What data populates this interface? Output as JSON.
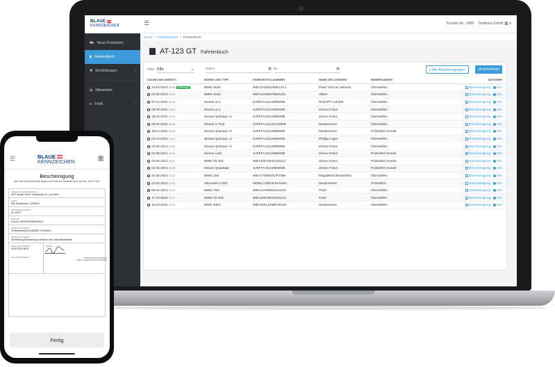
{
  "laptop": {
    "brand": {
      "top": "BLAUE",
      "bottom": "KENNZEICHEN"
    },
    "sidebar": {
      "items": [
        {
          "label": "Neue Probefahrt",
          "icon": "car-icon",
          "active": false
        },
        {
          "label": "Fahrtenbuch",
          "icon": "book-icon",
          "active": true
        },
        {
          "label": "Einstellungen",
          "icon": "gear-icon",
          "active": false,
          "caret": "‹"
        },
        {
          "label": "Mitarbeiter",
          "icon": "users-icon",
          "active": false
        },
        {
          "label": "Profil",
          "icon": "user-icon",
          "active": false,
          "caret": "‹"
        }
      ]
    },
    "topbar": {
      "customer": "Kunden-Nr.: 3000",
      "company": "Testfirma GmbH"
    },
    "breadcrumb": [
      "Home",
      "Fahrtenbücher",
      "Fahrtenbuch"
    ],
    "page": {
      "plate": "AT-123 GT",
      "title": "Fahrtenbuch"
    },
    "filters": {
      "filter_label": "Filter",
      "filter_value": "Alle",
      "from_label": "Datum",
      "to_label": "bis",
      "btn_all_certs": "Alle Bescheinigungen",
      "btn_logbook": "Fahrtenbuch"
    },
    "table": {
      "headers": [
        "DATUM UND UHRZEIT ↓",
        "MARKE UND TYPE",
        "FAHRGESTELLNUMMER",
        "NAME DES LENKERS",
        "BEMERKUNGEN",
        "AKTIONEN"
      ],
      "action_cert": "Bescheinigung",
      "action_info": "Info",
      "rows": [
        {
          "date": "14.04.2023",
          "time": "09:56",
          "badge": "Unterwegs",
          "vehicle": "BMW 318d",
          "vin": "WBA1234567890123 4",
          "driver": "Peter Test mit adresse",
          "note": "Überstellen"
        },
        {
          "date": "22.02.2023",
          "time": "20:05",
          "badge": "",
          "vehicle": "BMW 318d",
          "vin": "WBA12345678901234",
          "driver": "Albert",
          "note": "Überstellen"
        },
        {
          "date": "07.12.2022",
          "time": "08:59",
          "badge": "",
          "vehicle": "Nissan q+2",
          "vin": "SJNFFAJ11U2860095",
          "driver": "PHILIPP LUGER",
          "note": "Überstellen"
        },
        {
          "date": "05.09.2022",
          "time": "15:29",
          "badge": "",
          "vehicle": "Nissan q+2",
          "vin": "SJNFFAJ11U2860095",
          "driver": "Zinsen Franz",
          "note": "Überstellen"
        },
        {
          "date": "19.04.2022",
          "time": "15:00",
          "badge": "",
          "vehicle": "Nissan Qashqai +2",
          "vin": "SJNFFAJ11U2860095",
          "driver": "Zinsen Franz",
          "note": "Überstellen"
        },
        {
          "date": "06.04.2022",
          "time": "08:59",
          "badge": "",
          "vehicle": "Nissan X Trail",
          "vin": "SJNFFAJ11U2AA0095",
          "driver": "Mustermann",
          "note": "Überstellen"
        },
        {
          "date": "18.03.2022",
          "time": "08:09",
          "badge": "",
          "vehicle": "Nissan Qashqai +2",
          "vin": "SJNFFAJ11U2860095",
          "driver": "Mustermann",
          "note": "Probefahrt Kunde"
        },
        {
          "date": "02.12.2021",
          "time": "10:01",
          "badge": "",
          "vehicle": "Nissan Qashqai +2",
          "vin": "SJNFFAJ11U2860095",
          "driver": "Philipp Luger",
          "note": "Überstellen"
        },
        {
          "date": "23.06.2021",
          "time": "21:50",
          "badge": "",
          "vehicle": "Nissan Qashqai +2",
          "vin": "SJNFFAJ11U2860095",
          "driver": "Zinsen Franz",
          "note": "Überstellen"
        },
        {
          "date": "04.06.2021",
          "time": "09:59",
          "badge": "",
          "vehicle": "Nissan Leaf",
          "vin": "SJNFFAJ11U2860095",
          "driver": "Zinsen Franz",
          "note": "Probefahrt Kunde"
        },
        {
          "date": "04.06.2021",
          "time": "00:43",
          "badge": "",
          "vehicle": "BMW X6 30d",
          "vin": "WBA3457894V345J12",
          "driver": "Zinsen Franz",
          "note": "Probefahrt Kunde"
        },
        {
          "date": "04.06.2021",
          "time": "00:08",
          "badge": "",
          "vehicle": "Nissan Quashqai",
          "vin": "SJNFFAJ11U2860095",
          "driver": "Zinsen Franz",
          "note": "Probefahrt Kunde"
        },
        {
          "date": "01.05.2021",
          "time": "14:52",
          "badge": "",
          "vehicle": "BMW 116i",
          "vin": "WBA77689024JF2366",
          "driver": "Magdalena Musterfrau",
          "note": "Überstellen"
        },
        {
          "date": "14.04.2021",
          "time": "13:58",
          "badge": "",
          "vehicle": "Mercedes C300",
          "vin": "WDBCA45678JH23451",
          "driver": "Mustermann",
          "note": "Probefahrt"
        },
        {
          "date": "08.04.2021",
          "time": "23:18",
          "badge": "",
          "vehicle": "BMW 750i",
          "vin": "WBA12345904S44124",
          "driver": "Peter",
          "note": "Überstellen"
        },
        {
          "date": "17.10.2020",
          "time": "11:37",
          "badge": "",
          "vehicle": "BMW X6 30d",
          "vin": "WBA3457894V345J12",
          "driver": "Peter",
          "note": "Überstellen"
        },
        {
          "date": "16.10.2020",
          "time": "22:28",
          "badge": "",
          "vehicle": "BMW 2002",
          "vin": "WBA345L1299075D23",
          "driver": "Mustermann",
          "note": "Überstellen"
        }
      ]
    }
  },
  "phone": {
    "brand": {
      "top": "BLAUE",
      "bottom": "KENNZEICHEN"
    },
    "title": "Bescheinigung",
    "subtitle": "über Zeit und Zweck sowie Beginn und Ende der Probefahrt gem. §45 Abs. 6 KFG 1967",
    "doc": {
      "holder_label": "Inhaber des Probefahrtscheins",
      "holder_value": "MTG Handel GmbH, Hauptstraße 15, 1100 Wien",
      "driver_label": "Lenker",
      "driver_value": "Max Mustermann, 12345678",
      "plate_label": "Probefahrtkennzeichen",
      "plate_value": "AT-123GT",
      "vehicle_label": "Fahrzeug",
      "vehicle_value": "Audi A4, WAUZZZ8K9BA014601",
      "reason_label": "Zweck der Probefahrt",
      "reason_value": "Firmenfahrzeug für DAWIRZ TOGHWien",
      "purpose_label": "Zweck der Probefahrt",
      "purpose_value": "Überführung/Überstellung im Rahmen des Geschäftsbetriebes",
      "start_label": "Beginn der Probefahrt",
      "start_value": "06.06.2023 08:49",
      "end_label": "Ende der Probefahrt",
      "note_label": "Notizen",
      "signature_caption_1": "Unterschrift des Inhabers",
      "signature_caption_2": "Datum, Stempel und Unterschrift"
    },
    "done_button": "Fertig"
  },
  "colors": {
    "accent": "#3a9bd8",
    "sidebar": "#2c3136",
    "brand": "#0a3a7c",
    "success": "#28a745"
  }
}
